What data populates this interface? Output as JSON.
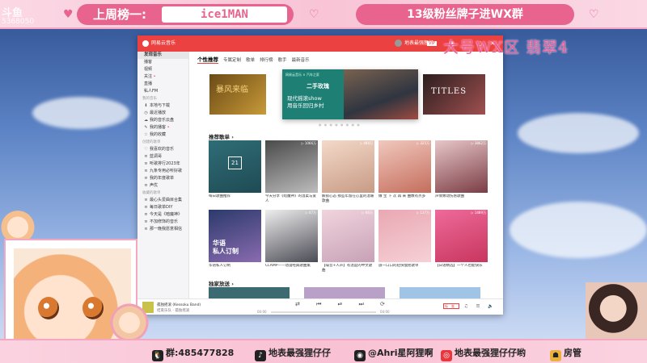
{
  "overlay": {
    "rank_label": "上周榜一:",
    "rank_name": "ice1MAN",
    "fan_group": "13级粉丝牌子进WX群",
    "watermark_text": "大号WX区 翡翠4",
    "corner_logo_big": "斗鱼",
    "corner_logo_id": "5368050",
    "bottom": [
      {
        "icon": "qq-icon",
        "label": "群:485477828"
      },
      {
        "icon": "tiktok-icon",
        "label": "地表最强狸仔仔"
      },
      {
        "icon": "weibo-icon",
        "label": "@Ahri星阿狸啊"
      },
      {
        "icon": "douyu-icon",
        "label": "地表最强狸仔仔哟"
      },
      {
        "icon": "manager-icon",
        "label": "房管"
      }
    ]
  },
  "app": {
    "name": "网易云音乐",
    "user_name": "地表最强狸仔",
    "vip": "VIP",
    "window_controls": "▣ — ▢ ✕",
    "sidebar": {
      "items": [
        {
          "label": "发现音乐",
          "active": true
        },
        {
          "label": "播客"
        },
        {
          "label": "视频"
        },
        {
          "label": "关注",
          "dot": true
        },
        {
          "label": "直播"
        },
        {
          "label": "私人FM"
        }
      ],
      "group_mine": "我的音乐",
      "mine": [
        {
          "icon": "⬇",
          "label": "本地与下载"
        },
        {
          "icon": "◷",
          "label": "最近播放"
        },
        {
          "icon": "☁",
          "label": "我的音乐云盘"
        },
        {
          "icon": "✎",
          "label": "我的播客",
          "dot": true
        },
        {
          "icon": "☆",
          "label": "我的收藏"
        }
      ],
      "group_created": "创建的歌单",
      "created": [
        {
          "icon": "♡",
          "label": "我喜欢的音乐"
        },
        {
          "icon": "≡",
          "label": "蓝调哥"
        },
        {
          "icon": "≡",
          "label": "听歌排行2023年"
        },
        {
          "icon": "≡",
          "label": "九条专用必听好歌"
        },
        {
          "icon": "≡",
          "label": "我的年度歌单"
        },
        {
          "icon": "≡",
          "label": "声优"
        }
      ],
      "group_collected": "收藏的歌单",
      "collected": [
        {
          "icon": "≡",
          "label": "最心头爱曲目合集"
        },
        {
          "icon": "≡",
          "label": "每日歌单DIY"
        },
        {
          "icon": "≡",
          "label": "今天是《暗魔神》"
        },
        {
          "icon": "≡",
          "label": "不加修饰的音乐"
        },
        {
          "icon": "≡",
          "label": "那一晚我愿意相信"
        }
      ]
    },
    "tabs": [
      "个性推荐",
      "专属定制",
      "歌单",
      "排行榜",
      "歌手",
      "最新音乐"
    ],
    "banners": {
      "left_text": "暴风来临",
      "center_logo": "网易云音乐 × 汽车之家",
      "center_title": "二手玫瑰",
      "center_sub_1": "现代摇滚show",
      "center_sub_2": "用音乐回归乡村",
      "right_text": "TITLES"
    },
    "section_recommend": "推荐歌单 ›",
    "section_exclusive": "独家放送 ›",
    "playlists": [
      {
        "title": "每日歌曲推荐",
        "plays": "",
        "calendar": "21"
      },
      {
        "title": "今天分享《暗魔神》的温柔与爱人",
        "plays": "▷ 1066万"
      },
      {
        "title": "解锁心态 那些年留在心里的温暖歌曲",
        "plays": "▷ 489万"
      },
      {
        "title": "做 宝 下 次 再 来 曲数有点多",
        "plays": "▷ 325万"
      },
      {
        "title": "声情致动伤感歌曲",
        "plays": "▷ 3862万"
      },
      {
        "title": "华语私人订制",
        "plays": "",
        "cover_text_1": "华语",
        "cover_text_2": "私人订制"
      },
      {
        "title": "CLAMP——动漫经典歌曲集",
        "plays": "▷ 47万"
      },
      {
        "title": "【噪音+人声】有温度的中文歌曲",
        "plays": "▷ 66万"
      },
      {
        "title": "旅一口口的轻快慢摇歌单",
        "plays": "▷ 137万"
      },
      {
        "title": "【日语精选】一个人也能快乐",
        "plays": "▷ 1489万"
      }
    ],
    "player": {
      "song": "孤独摇滚 (Kessoku Band)",
      "artist": "结束乐队 · 孤独摇滚",
      "time_current": "00:00",
      "time_total": "04:00",
      "controls": "⇄ ⏮ ⏯ ⏭ ⟳",
      "quality": "标准",
      "right_icons": "♫ ☰ 🔈"
    }
  },
  "colors": {
    "brand_red": "#ec4141",
    "overlay_pink": "#e8638e"
  }
}
